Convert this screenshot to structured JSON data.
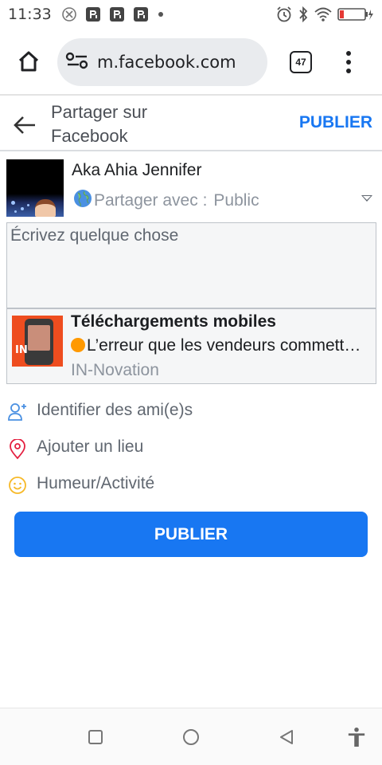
{
  "status_bar": {
    "time": "11:33",
    "icons": [
      "blocked-notification-icon",
      "p-app-icon",
      "p-app-icon",
      "p-app-icon",
      "dot-icon",
      "alarm-icon",
      "bluetooth-icon",
      "wifi-icon",
      "battery-icon"
    ]
  },
  "browser": {
    "url": "m.facebook.com",
    "tab_count": "47"
  },
  "header": {
    "title": "Partager sur Facebook",
    "publish_label": "PUBLIER"
  },
  "post": {
    "user_name": "Aka Ahia Jennifer",
    "privacy_label": "Partager avec :",
    "privacy_value": "Public",
    "composer_placeholder": "Écrivez quelque chose"
  },
  "link_preview": {
    "title": "Téléchargements mobiles",
    "description": "L’erreur que les vendeurs commettent",
    "domain": "IN-Novation",
    "thumb_logo": "IN"
  },
  "actions": [
    {
      "label": "Identifier des ami(e)s",
      "icon": "tag-friends-icon"
    },
    {
      "label": "Ajouter un lieu",
      "icon": "location-pin-icon"
    },
    {
      "label": "Humeur/Activité",
      "icon": "smiley-icon"
    }
  ],
  "publish_button": "PUBLIER",
  "colors": {
    "accent": "#1877f2",
    "secondary_text": "#606770",
    "location_pin": "#e41e3f",
    "smiley": "#f7b928"
  }
}
